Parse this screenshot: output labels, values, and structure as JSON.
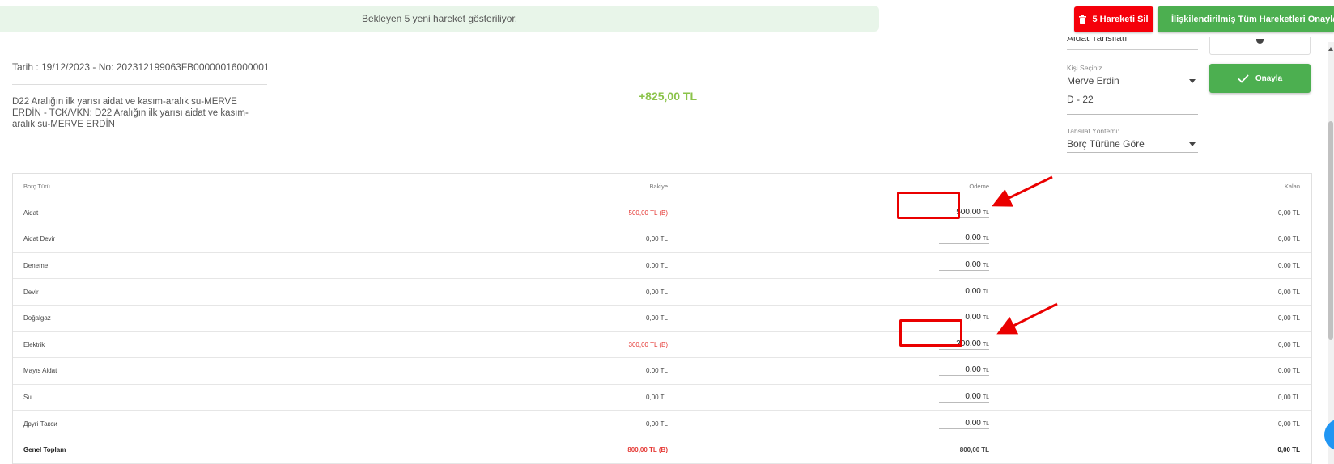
{
  "notice": {
    "text": "Bekleyen 5 yeni hareket gösteriliyor."
  },
  "actions": {
    "delete_label": "5 Hareketi Sil",
    "approve_all_label": "İlişkilendirilmiş Tüm Hareketleri Onayla"
  },
  "transaction": {
    "date_line": "Tarih : 19/12/2023 - No: 202312199063FB00000016000001",
    "description": "D22 Aralığın ilk yarısı aidat ve kasım-aralık su-MERVE ERDİN - TCK/VKN: D22 Aralığın ilk yarısı aidat ve kasım-aralık su-MERVE ERDİN",
    "amount": "+825,00 TL"
  },
  "panel": {
    "top_select_value": "Aidat Tahsilatı",
    "person_label": "Kişi Seçiniz",
    "person_value": "Merve Erdin",
    "unit_value": "D - 22",
    "method_label": "Tahsilat Yöntemi:",
    "method_value": "Borç Türüne Göre",
    "approve_label": "Onayla"
  },
  "table": {
    "headers": {
      "type": "Borç Türü",
      "balance": "Bakiye",
      "payment": "Ödeme",
      "remaining": "Kalan"
    },
    "rows": [
      {
        "type": "Aidat",
        "balance": "500,00 TL (B)",
        "balance_red": true,
        "payment": "500,00",
        "remaining": "0,00 TL"
      },
      {
        "type": "Aidat Devir",
        "balance": "0,00 TL",
        "balance_red": false,
        "payment": "0,00",
        "remaining": "0,00 TL"
      },
      {
        "type": "Deneme",
        "balance": "0,00 TL",
        "balance_red": false,
        "payment": "0,00",
        "remaining": "0,00 TL"
      },
      {
        "type": "Devir",
        "balance": "0,00 TL",
        "balance_red": false,
        "payment": "0,00",
        "remaining": "0,00 TL"
      },
      {
        "type": "Doğalgaz",
        "balance": "0,00 TL",
        "balance_red": false,
        "payment": "0,00",
        "remaining": "0,00 TL"
      },
      {
        "type": "Elektrik",
        "balance": "300,00 TL (B)",
        "balance_red": true,
        "payment": "300,00",
        "remaining": "0,00 TL"
      },
      {
        "type": "Mayıs Aidat",
        "balance": "0,00 TL",
        "balance_red": false,
        "payment": "0,00",
        "remaining": "0,00 TL"
      },
      {
        "type": "Su",
        "balance": "0,00 TL",
        "balance_red": false,
        "payment": "0,00",
        "remaining": "0,00 TL"
      },
      {
        "type": "Другі Такси",
        "balance": "0,00 TL",
        "balance_red": false,
        "payment": "0,00",
        "remaining": "0,00 TL"
      }
    ],
    "payment_unit": "TL",
    "total": {
      "type": "Genel Toplam",
      "balance": "800,00 TL (B)",
      "payment": "800,00",
      "payment_unit": "TL",
      "remaining": "0,00 TL"
    }
  },
  "colors": {
    "notice_bg": "#e8f5e9",
    "danger": "#f5000a",
    "success": "#4caf50",
    "amount": "#8bc34a",
    "debt_red": "#e53935",
    "annotation_red": "#ea0000"
  },
  "icons": {
    "delete": "trash-icon",
    "approve": "check-icon",
    "dropdown": "caret-down-icon"
  }
}
